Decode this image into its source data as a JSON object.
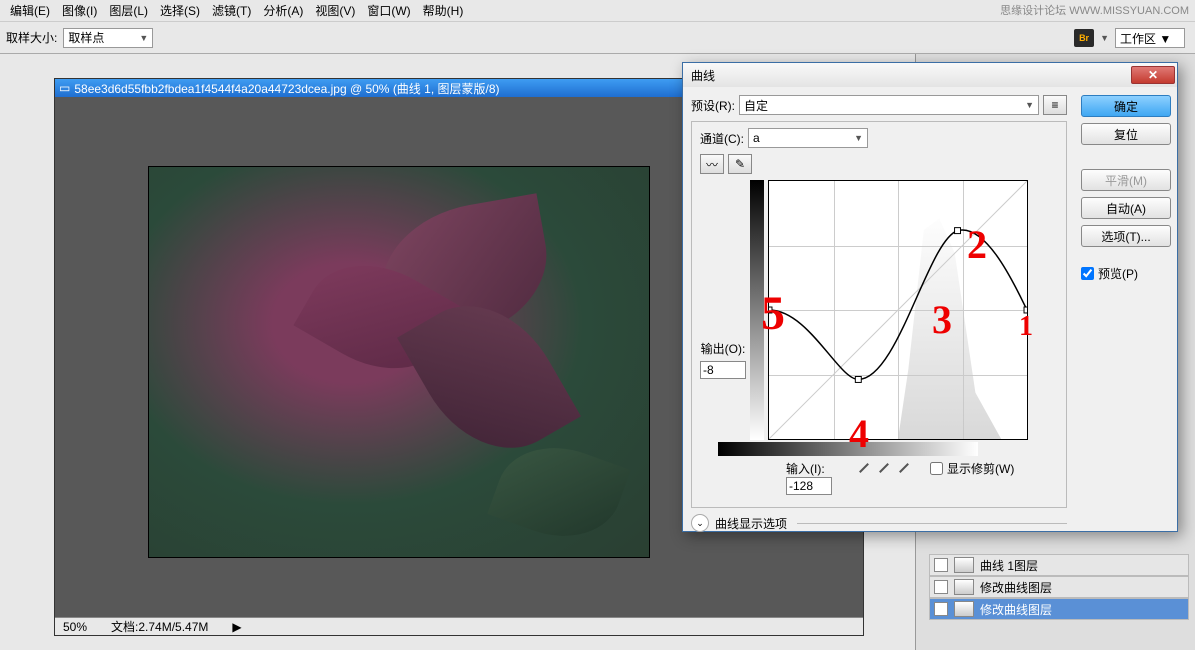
{
  "watermark": "思缘设计论坛 WWW.MISSYUAN.COM",
  "menu": {
    "edit": "编辑(E)",
    "image": "图像(I)",
    "layer": "图层(L)",
    "select": "选择(S)",
    "filter": "滤镜(T)",
    "analysis": "分析(A)",
    "view": "视图(V)",
    "window": "窗口(W)",
    "help": "帮助(H)"
  },
  "options": {
    "sample_label": "取样大小:",
    "sample_value": "取样点"
  },
  "workspace": {
    "label": "工作区 ▼"
  },
  "document": {
    "title": "58ee3d6d55fbb2fbdea1f4544f4a20a44723dcea.jpg @ 50% (曲线 1, 图层蒙版/8)",
    "zoom": "50%",
    "status": "文档:2.74M/5.47M"
  },
  "dialog": {
    "title": "曲线",
    "preset_label": "预设(R):",
    "preset_value": "自定",
    "channel_label": "通道(C):",
    "channel_value": "a",
    "output_label": "输出(O):",
    "output_value": "-8",
    "input_label": "输入(I):",
    "input_value": "-128",
    "show_clip": "显示修剪(W)",
    "expand": "曲线显示选项",
    "ok": "确定",
    "reset": "复位",
    "smooth": "平滑(M)",
    "auto": "自动(A)",
    "options": "选项(T)...",
    "preview": "预览(P)"
  },
  "layers": {
    "row1": "曲线 1图层",
    "row2": "修改曲线图层",
    "row3": "修改曲线图层"
  },
  "annotations": {
    "n1": "1",
    "n2": "2",
    "n3": "3",
    "n4": "4",
    "n5": "5"
  }
}
